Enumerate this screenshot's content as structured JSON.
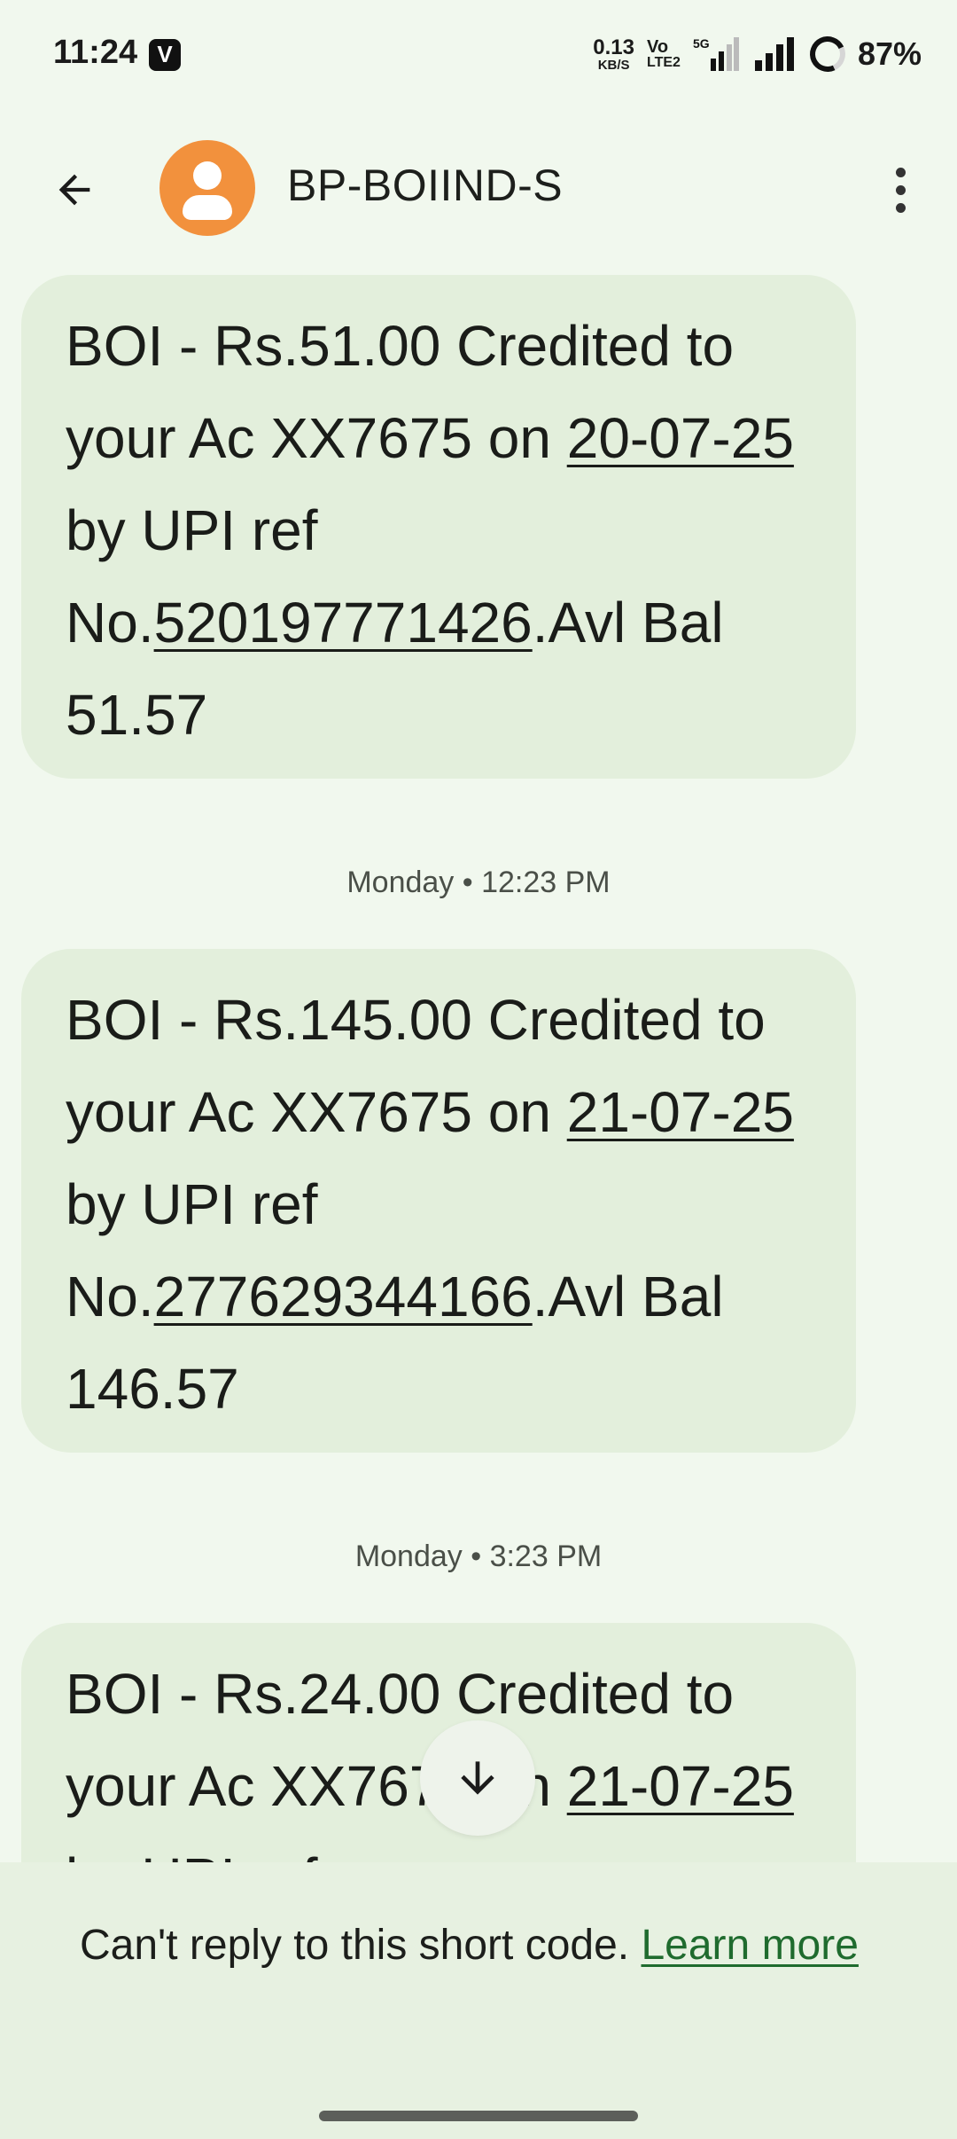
{
  "status_bar": {
    "time": "11:24",
    "net_speed_value": "0.13",
    "net_speed_unit": "KB/S",
    "volte_top": "Vo",
    "volte_bottom": "LTE2",
    "network_5g": "5G",
    "battery": "87%"
  },
  "header": {
    "contact_name": "BP-BOIIND-S",
    "back_icon": "arrow-back-icon",
    "more_icon": "more-vert-icon"
  },
  "messages": [
    {
      "prefix": "BOI -  Rs.51.00 Credited to your Ac XX7675 on ",
      "date": "20-07-25",
      "middle": " by UPI ref No.",
      "ref": "520197771426",
      "suffix": ".Avl Bal 51.57"
    },
    {
      "prefix": "BOI -  Rs.145.00 Credited to your Ac XX7675 on ",
      "date": "21-07-25",
      "middle": " by UPI ref No.",
      "ref": "277629344166",
      "suffix": ".Avl Bal 146.57"
    },
    {
      "prefix": "BOI -  Rs.24.00 Credited to your Ac XX7675 on ",
      "date": "21-07-25",
      "middle": " by UPI ref",
      "ref": "",
      "suffix": ""
    }
  ],
  "timestamps": [
    "Monday • 12:23 PM",
    "Monday • 3:23 PM"
  ],
  "footer": {
    "text": "Can't reply to this short code. ",
    "link": "Learn more"
  },
  "colors": {
    "background": "#f1f8ee",
    "bubble": "#e3efdc",
    "avatar": "#f2913d",
    "link": "#1f6b2e"
  }
}
